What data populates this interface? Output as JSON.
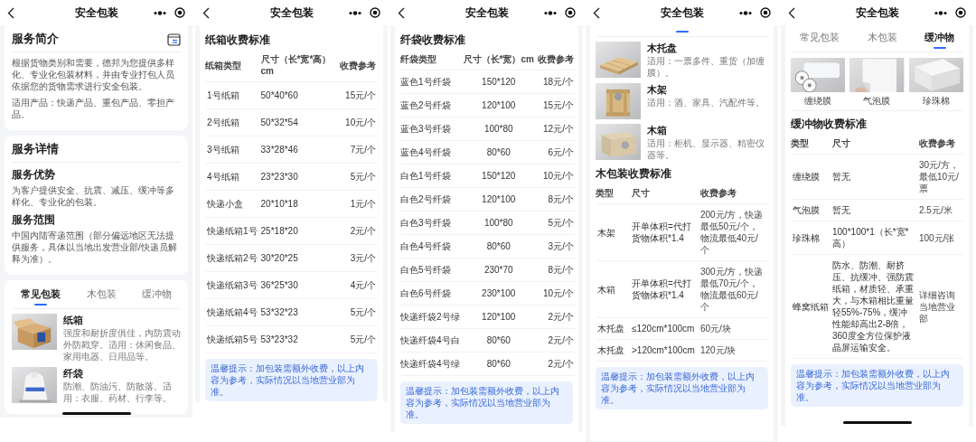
{
  "screens": [
    {
      "kind": "overview",
      "title": "安全包装",
      "intro": {
        "heading": "服务简介",
        "paragraphs": [
          "根据货物类别和需要，德邦为您提供多样化、专业化包装材料，并由专业打包人员依据您的货物需求进行安全包装。",
          "适用产品：快递产品、重包产品、零担产品。"
        ]
      },
      "details": {
        "heading": "服务详情",
        "sections": [
          {
            "heading": "服务优势",
            "text": "为客户提供安全、抗震、减压、缓冲等多样化、专业化的包装。"
          },
          {
            "heading": "服务范围",
            "text": "中国内陆寄递范围（部分偏远地区无法提供服务，具体以当地出发营业部/快递员解释为准）。"
          }
        ]
      },
      "tabs": [
        {
          "label": "常见包装",
          "selected": true
        },
        {
          "label": "木包装",
          "selected": false
        },
        {
          "label": "缓冲物",
          "selected": false
        }
      ],
      "products": [
        {
          "name": "纸箱",
          "description": "强度和耐折度俱佳，内防震动外防戳穿。适用：休闲食品、家用电器、日用品等。"
        },
        {
          "name": "纤袋",
          "description": "防潮、防油污、防散落。适用：衣服、药材、行李等。"
        }
      ],
      "home_indicator": true
    },
    {
      "kind": "box_prices",
      "title": "安全包装",
      "table": {
        "title": "纸箱收费标准",
        "columns": [
          "纸箱类型",
          "尺寸（长*宽*高）cm",
          "收费参考"
        ],
        "rows": [
          [
            "1号纸箱",
            "50*40*60",
            "15元/个"
          ],
          [
            "2号纸箱",
            "50*32*54",
            "10元/个"
          ],
          [
            "3号纸箱",
            "33*28*46",
            "7元/个"
          ],
          [
            "4号纸箱",
            "23*23*30",
            "5元/个"
          ],
          [
            "快递小盒",
            "20*10*18",
            "1元/个"
          ],
          [
            "快递纸箱1号",
            "25*18*20",
            "2元/个"
          ],
          [
            "快递纸箱2号",
            "30*20*25",
            "3元/个"
          ],
          [
            "快递纸箱3号",
            "36*25*30",
            "4元/个"
          ],
          [
            "快递纸箱4号",
            "53*32*23",
            "5元/个"
          ],
          [
            "快递纸箱5号",
            "53*23*32",
            "5元/个"
          ]
        ]
      },
      "tip": "温馨提示：加包装需额外收费，以上内容为参考，实际情况以当地营业部为准。"
    },
    {
      "kind": "bag_prices",
      "title": "安全包装",
      "table": {
        "title": "纤袋收费标准",
        "columns": [
          "纤袋类型",
          "尺寸（长*宽）cm",
          "收费参考"
        ],
        "rows": [
          [
            "蓝色1号纤袋",
            "150*120",
            "18元/个"
          ],
          [
            "蓝色2号纤袋",
            "120*100",
            "15元/个"
          ],
          [
            "蓝色3号纤袋",
            "100*80",
            "12元/个"
          ],
          [
            "蓝色4号纤袋",
            "80*60",
            "6元/个"
          ],
          [
            "白色1号纤袋",
            "150*120",
            "10元/个"
          ],
          [
            "白色2号纤袋",
            "120*100",
            "8元/个"
          ],
          [
            "白色3号纤袋",
            "100*80",
            "5元/个"
          ],
          [
            "白色4号纤袋",
            "80*60",
            "3元/个"
          ],
          [
            "白色5号纤袋",
            "230*70",
            "8元/个"
          ],
          [
            "白色6号纤袋",
            "230*100",
            "10元/个"
          ],
          [
            "快递纤袋2号绿",
            "120*100",
            "2元/个"
          ],
          [
            "快递纤袋4号白",
            "80*60",
            "2元/个"
          ],
          [
            "快递纤袋4号绿",
            "80*60",
            "2元/个"
          ]
        ]
      },
      "tip": "温馨提示：加包装需额外收费，以上内容为参考，实际情况以当地营业部为准。"
    },
    {
      "kind": "wood",
      "title": "安全包装",
      "tab_indicator": true,
      "products": [
        {
          "name": "木托盘",
          "description": "适用：一票多件、重货（加缠膜）。"
        },
        {
          "name": "木架",
          "description": "适用：酒、家具、汽配件等。"
        },
        {
          "name": "木箱",
          "description": "适用：柜机、显示器、精密仪器等。"
        }
      ],
      "table": {
        "title": "木包装收费标准",
        "columns": [
          "类型",
          "尺寸",
          "收费参考"
        ],
        "rows": [
          [
            "木架",
            "开单体积=代打货物体积*1.4",
            "200元/方，快递最低50元/个，物流最低40元/个"
          ],
          [
            "木箱",
            "开单体积=代打货物体积*1.4",
            "300元/方，快递最低70元/个，物流最低60元/个"
          ],
          [
            "木托盘",
            "≤120cm*100cm",
            "60元/块"
          ],
          [
            "木托盘",
            ">120cm*100cm",
            "120元/块"
          ]
        ]
      },
      "tip": "温馨提示：加包装需额外收费，以上内容为参考，实际情况以当地营业部为准。"
    },
    {
      "kind": "cushion",
      "title": "安全包装",
      "tabs": [
        {
          "label": "常见包装",
          "selected": false
        },
        {
          "label": "木包装",
          "selected": false
        },
        {
          "label": "缓冲物",
          "selected": true
        }
      ],
      "materials": [
        {
          "name": "缠绕膜"
        },
        {
          "name": "气泡膜"
        },
        {
          "name": "珍珠棉"
        }
      ],
      "table": {
        "title": "缓冲物收费标准",
        "columns": [
          "类型",
          "尺寸",
          "收费参考"
        ],
        "rows": [
          [
            "缠绕膜",
            "暂无",
            "30元/方，最低10元/票"
          ],
          [
            "气泡膜",
            "暂无",
            "2.5元/米"
          ],
          [
            "珍珠棉",
            "100*100*1（长*宽*高）",
            "100元/张"
          ],
          [
            "蜂窝纸箱",
            "防水、防潮、耐挤压、抗缓冲、强防震纸箱，材质轻、承重大，与木箱相比重量轻55%-75%，缓冲性能却高出2-8倍，360度全方位保护液晶屏运输安全。",
            "详细咨询当地营业部"
          ]
        ]
      },
      "tip": "温馨提示：加包装需额外收费，以上内容为参考，实际情况以当地营业部为准。",
      "home_indicator": true
    }
  ]
}
